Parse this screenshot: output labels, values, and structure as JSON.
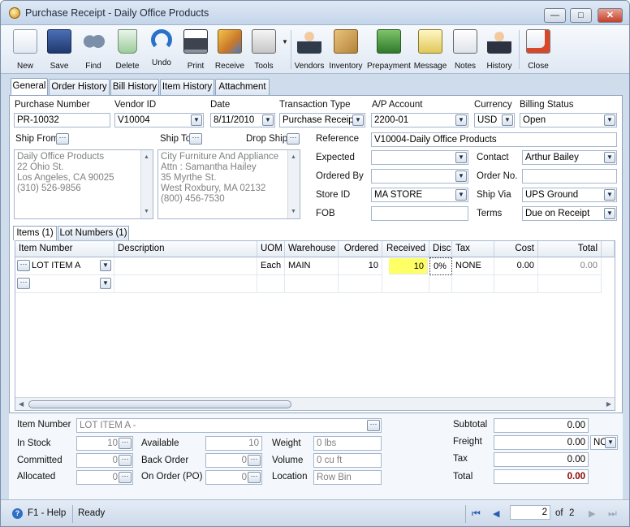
{
  "window": {
    "title": "Purchase Receipt - Daily Office Products"
  },
  "toolbar": {
    "items": [
      {
        "label": "New",
        "icon": "new-icon"
      },
      {
        "label": "Save",
        "icon": "save-icon"
      },
      {
        "label": "Find",
        "icon": "find-icon"
      },
      {
        "label": "Delete",
        "icon": "delete-icon"
      },
      {
        "label": "Undo",
        "icon": "undo-icon"
      },
      {
        "label": "Print",
        "icon": "print-icon"
      },
      {
        "label": "Receive",
        "icon": "receive-icon"
      },
      {
        "label": "Tools",
        "icon": "tools-icon"
      },
      {
        "label": "Vendors",
        "icon": "vendors-icon"
      },
      {
        "label": "Inventory",
        "icon": "inventory-icon"
      },
      {
        "label": "Prepayment",
        "icon": "prepayment-icon"
      },
      {
        "label": "Message",
        "icon": "message-icon"
      },
      {
        "label": "Notes",
        "icon": "notes-icon"
      },
      {
        "label": "History",
        "icon": "history-icon"
      },
      {
        "label": "Close",
        "icon": "close-icon"
      }
    ]
  },
  "tabs": [
    "General",
    "Order History",
    "Bill History",
    "Item History",
    "Attachment"
  ],
  "header": {
    "purchase_number_label": "Purchase Number",
    "purchase_number": "PR-10032",
    "vendor_id_label": "Vendor ID",
    "vendor_id": "V10004",
    "date_label": "Date",
    "date": "8/11/2010",
    "transaction_type_label": "Transaction Type",
    "transaction_type": "Purchase Receipt",
    "ap_account_label": "A/P Account",
    "ap_account": "2200-01",
    "currency_label": "Currency",
    "currency": "USD",
    "billing_status_label": "Billing Status",
    "billing_status": "Open"
  },
  "ship_from": {
    "label": "Ship From",
    "lines": [
      "Daily Office Products",
      "22 Ohio St.",
      "Los Angeles, CA 90025",
      "(310) 526-9856"
    ]
  },
  "ship_to": {
    "label": "Ship To",
    "drop_ship_label": "Drop Ship",
    "lines": [
      "City Furniture And Appliance",
      "Attn : Samantha Hailey",
      "35 Myrthe St.",
      "West Roxbury, MA 02132",
      "(800) 456-7530"
    ]
  },
  "details": {
    "reference_label": "Reference",
    "reference": "V10004-Daily Office Products",
    "expected_label": "Expected",
    "expected": "",
    "ordered_by_label": "Ordered By",
    "ordered_by": "",
    "store_id_label": "Store ID",
    "store_id": "MA STORE",
    "fob_label": "FOB",
    "fob": "",
    "contact_label": "Contact",
    "contact": "Arthur Bailey",
    "order_no_label": "Order No.",
    "order_no": "",
    "ship_via_label": "Ship Via",
    "ship_via": "UPS Ground",
    "terms_label": "Terms",
    "terms": "Due on Receipt"
  },
  "subtabs": [
    "Items (1)",
    "Lot Numbers (1)"
  ],
  "grid": {
    "columns": [
      "Item Number",
      "Description",
      "UOM",
      "Warehouse",
      "Ordered",
      "Received",
      "Disc",
      "Tax",
      "Cost",
      "Total"
    ],
    "rows": [
      {
        "item_number": "LOT ITEM A",
        "description": "",
        "uom": "Each",
        "warehouse": "MAIN",
        "ordered": "10",
        "received": "10",
        "disc": "0%",
        "tax": "NONE",
        "cost": "0.00",
        "total": "0.00"
      }
    ],
    "highlight_color": "#ffff66"
  },
  "item_info": {
    "item_number_label": "Item Number",
    "item_number": "LOT ITEM A -",
    "in_stock_label": "In Stock",
    "in_stock": "10",
    "committed_label": "Committed",
    "committed": "0",
    "allocated_label": "Allocated",
    "allocated": "0",
    "available_label": "Available",
    "available": "10",
    "back_order_label": "Back Order",
    "back_order": "0",
    "on_order_label": "On Order (PO)",
    "on_order": "0",
    "weight_label": "Weight",
    "weight": "0 lbs",
    "volume_label": "Volume",
    "volume": "0 cu ft",
    "location_label": "Location",
    "location": "Row  Bin"
  },
  "totals": {
    "subtotal_label": "Subtotal",
    "subtotal": "0.00",
    "freight_label": "Freight",
    "freight": "0.00",
    "freight_code": "NO",
    "tax_label": "Tax",
    "tax": "0.00",
    "total_label": "Total",
    "total": "0.00",
    "total_color": "#8b0000"
  },
  "status": {
    "help": "F1 - Help",
    "state": "Ready",
    "page": "2",
    "of_label": "of",
    "page_count": "2"
  }
}
